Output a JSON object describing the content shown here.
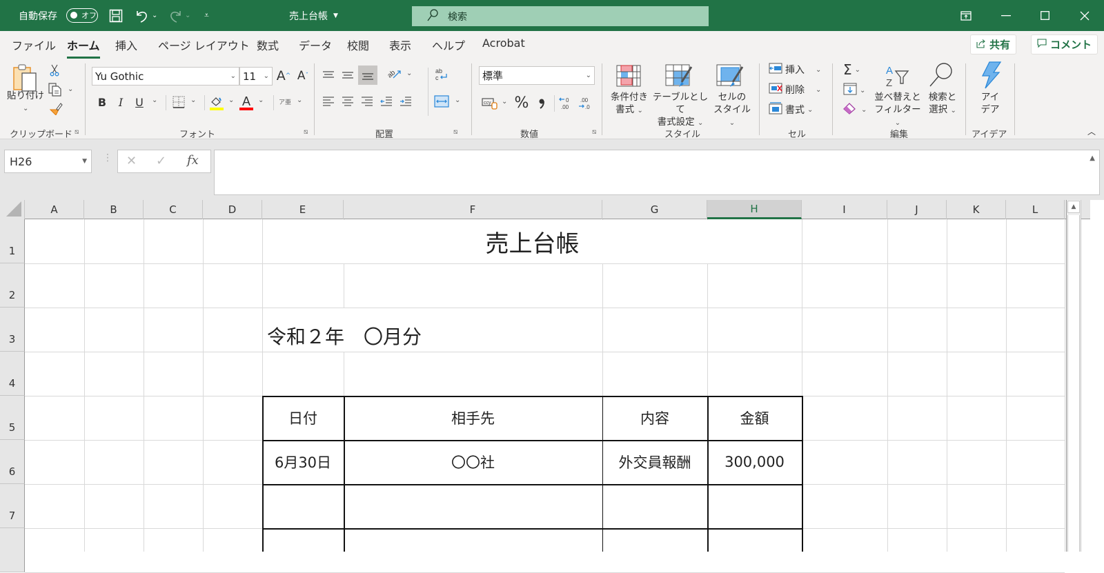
{
  "titlebar": {
    "autosave_label": "自動保存",
    "autosave_state": "オフ",
    "doc_title": "売上台帳",
    "search_placeholder": "検索",
    "icons": [
      "save-icon",
      "undo-icon",
      "redo-icon",
      "customize-qat-icon",
      "ribbon-display-icon",
      "minimize-icon",
      "maximize-icon",
      "close-icon"
    ],
    "brand_color": "#217346"
  },
  "menu": {
    "tabs": [
      {
        "label": "ファイル"
      },
      {
        "label": "ホーム",
        "active": true
      },
      {
        "label": "挿入"
      },
      {
        "label": "ページ レイアウト"
      },
      {
        "label": "数式"
      },
      {
        "label": "データ"
      },
      {
        "label": "校閲"
      },
      {
        "label": "表示"
      },
      {
        "label": "ヘルプ"
      },
      {
        "label": "Acrobat"
      }
    ],
    "share_label": "共有",
    "comment_label": "コメント"
  },
  "ribbon": {
    "clipboard": {
      "label": "クリップボード",
      "paste_label": "貼り付け"
    },
    "font": {
      "label": "フォント",
      "font_name": "Yu Gothic",
      "font_size": "11",
      "bold": "B",
      "italic": "I",
      "underline": "U",
      "ruby": "ア亜"
    },
    "alignment": {
      "label": "配置"
    },
    "number": {
      "label": "数値",
      "format": "標準",
      "percent": "%",
      "comma": "❟"
    },
    "styles": {
      "label": "スタイル",
      "conditional_line1": "条件付き",
      "conditional_line2": "書式",
      "table_line1": "テーブルとして",
      "table_line2": "書式設定",
      "cellstyle_line1": "セルの",
      "cellstyle_line2": "スタイル"
    },
    "cells": {
      "label": "セル",
      "insert": "挿入",
      "delete": "削除",
      "format": "書式"
    },
    "editing": {
      "label": "編集",
      "sort_line1": "並べ替えと",
      "sort_line2": "フィルター",
      "find_line1": "検索と",
      "find_line2": "選択",
      "sigma": "Σ"
    },
    "ideas": {
      "label": "アイデア",
      "btn_line1": "アイ",
      "btn_line2": "デア"
    }
  },
  "formula_bar": {
    "name_box": "H26",
    "cancel": "✕",
    "enter": "✓",
    "fx": "fx",
    "value": ""
  },
  "sheet": {
    "columns": [
      "A",
      "B",
      "C",
      "D",
      "E",
      "F",
      "G",
      "H",
      "I",
      "J",
      "K",
      "L"
    ],
    "selected_column": "H",
    "rows": [
      "1",
      "2",
      "3",
      "4",
      "5",
      "6",
      "7"
    ],
    "title": "売上台帳",
    "period": "令和２年　〇月分",
    "table": {
      "headers": [
        "日付",
        "相手先",
        "内容",
        "金額"
      ],
      "rows": [
        [
          "6月30日",
          "〇〇社",
          "外交員報酬",
          "300,000"
        ],
        [
          "",
          "",
          "",
          ""
        ]
      ]
    }
  }
}
